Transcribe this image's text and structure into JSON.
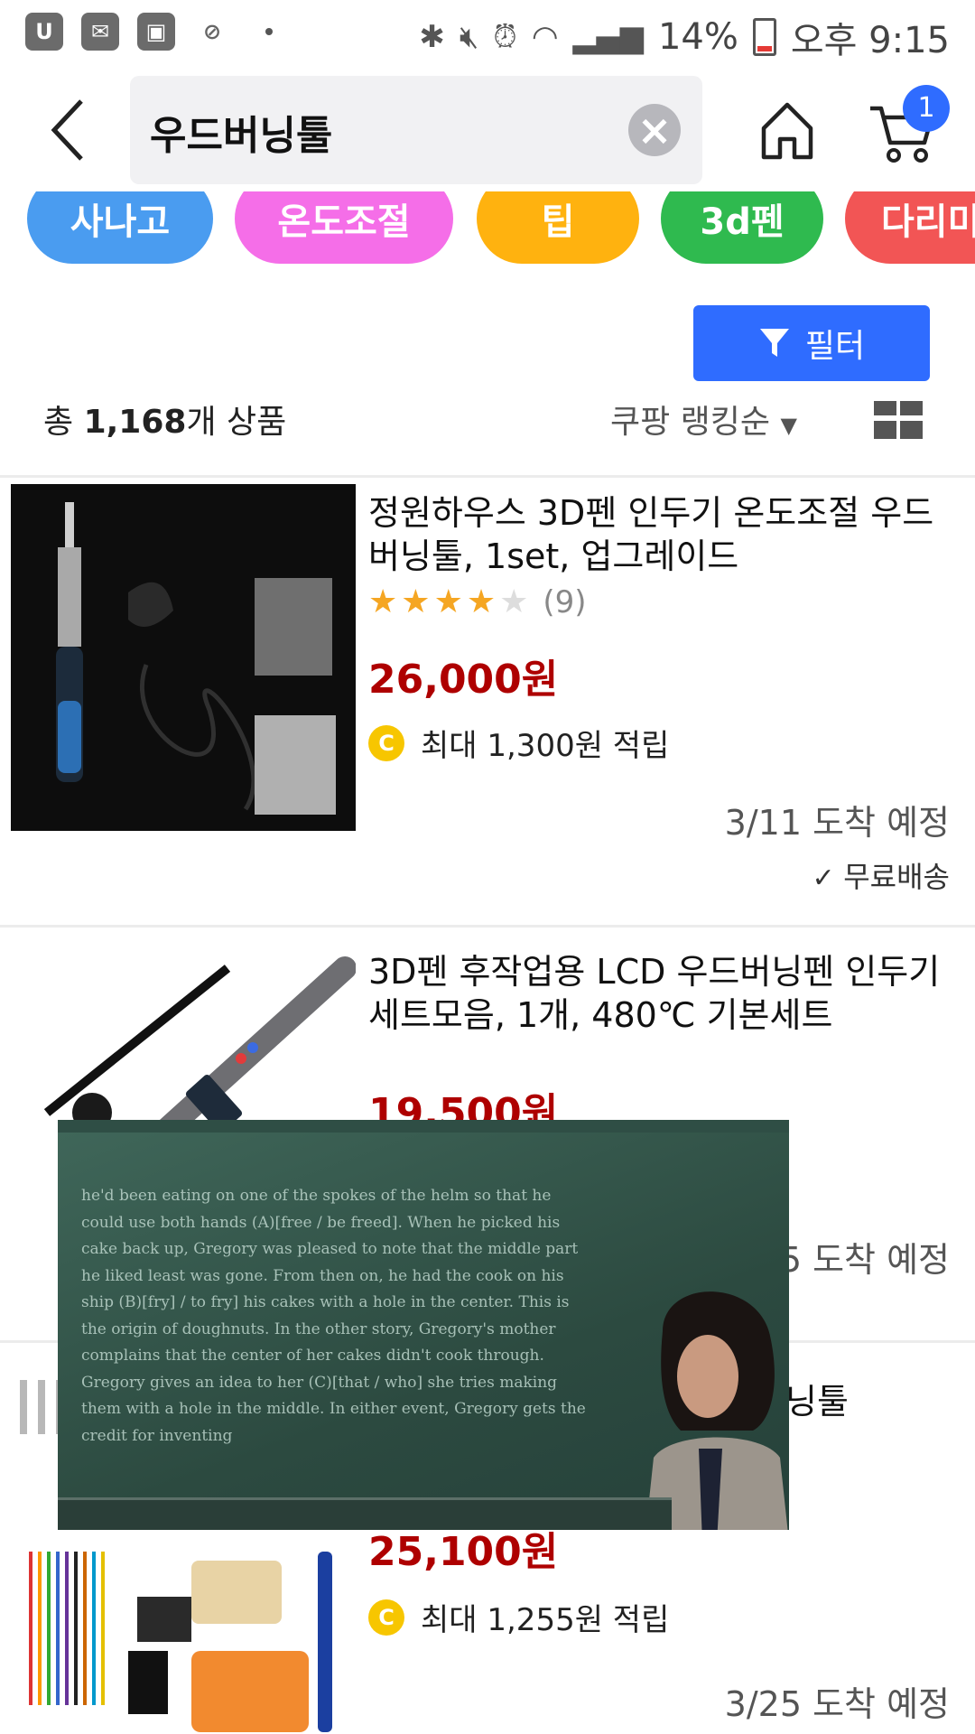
{
  "status_bar": {
    "left_icons": [
      "u-plus-icon",
      "mail-icon",
      "twitch-icon",
      "pill-icon"
    ],
    "battery": "14%",
    "time": "오후 9:15"
  },
  "header": {
    "search_value": "우드버닝툴",
    "cart_badge": "1"
  },
  "chips": [
    {
      "label": "사나고",
      "color": "#4a9cf0"
    },
    {
      "label": "온도조절",
      "color": "#f56ee8"
    },
    {
      "label": "팁",
      "color": "#ffb20f"
    },
    {
      "label": "3d펜",
      "color": "#2fba4f"
    },
    {
      "label": "다리미",
      "color": "#f25555"
    }
  ],
  "filter_label": "필터",
  "result_count": {
    "prefix": "총 ",
    "number": "1,168",
    "suffix": "개 상품"
  },
  "sort_label": "쿠팡 랭킹순",
  "products": [
    {
      "title": "정원하우스 3D펜 인두기 온도조절 우드버닝툴, 1set, 업그레이드",
      "rating": 4,
      "review_count": "(9)",
      "price": "26,000원",
      "reward": "최대 1,300원 적립",
      "delivery": "3/11 도착 예정",
      "shipping": "무료배송"
    },
    {
      "title": "3D펜 후작업용 LCD 우드버닝펜 인두기 세트모음, 1개, 480℃ 기본세트",
      "price": "19,500원",
      "delivery_partial": "5 도착 예정"
    },
    {
      "title_partial": "닝툴",
      "price": "25,100원",
      "reward": "최대 1,255원 적립",
      "delivery": "3/25 도착 예정"
    }
  ],
  "video_overlay": {
    "board_text": "he'd been eating on one of the spokes of the helm so that he could use both hands (A)[free / be freed]. When he picked his cake back up, Gregory was pleased to note that the middle part he liked least was gone. From then on, he had the cook on his ship (B)[fry] / to fry] his cakes with a hole in the center. This is the origin of doughnuts. In the other story, Gregory's mother complains that the center of her cakes didn't cook through. Gregory gives an idea to her (C)[that / who] she tries making them with a hole in the middle. In either event, Gregory gets the credit for inventing"
  }
}
